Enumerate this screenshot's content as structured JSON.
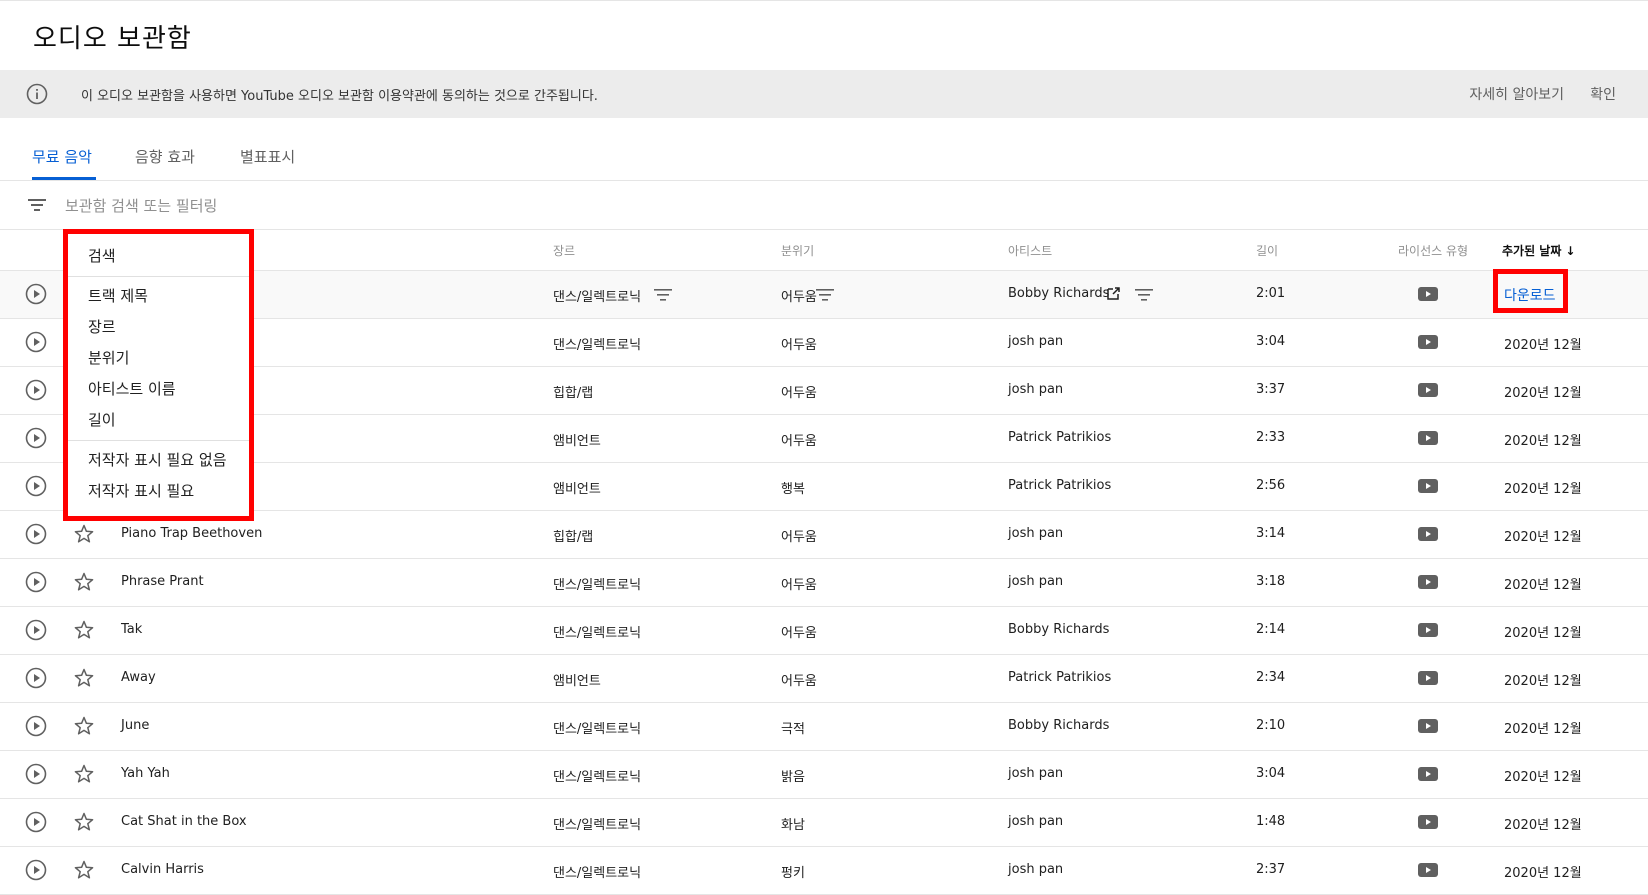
{
  "page": {
    "title": "오디오 보관함"
  },
  "notice": {
    "text": "이 오디오 보관함을 사용하면 YouTube 오디오 보관함 이용약관에 동의하는 것으로 간주됩니다.",
    "learn_more": "자세히 알아보기",
    "confirm": "확인"
  },
  "tabs": [
    {
      "label": "무료 음악",
      "active": true
    },
    {
      "label": "음향 효과",
      "active": false
    },
    {
      "label": "별표표시",
      "active": false
    }
  ],
  "filter": {
    "placeholder": "보관함 검색 또는 필터링",
    "value": ""
  },
  "columns": {
    "genre": "장르",
    "mood": "분위기",
    "artist": "아티스트",
    "length": "길이",
    "license": "라이선스 유형",
    "date_added": "추가된 날짜"
  },
  "sort": {
    "column": "date_added",
    "direction": "desc",
    "icon": "arrow-down-icon"
  },
  "filter_menu": {
    "items": [
      "검색",
      "트랙 제목",
      "장르",
      "분위기",
      "아티스트 이름",
      "길이",
      "저작자 표시 필요 없음",
      "저작자 표시 필요"
    ]
  },
  "rows": [
    {
      "title": "",
      "genre": "댄스/일렉트로닉",
      "mood": "어두움",
      "artist": "Bobby Richards",
      "length": "2:01",
      "license_icon": "youtube-icon",
      "date": "",
      "download": "다운로드"
    },
    {
      "title": "",
      "genre": "댄스/일렉트로닉",
      "mood": "어두움",
      "artist": "josh pan",
      "length": "3:04",
      "license_icon": "youtube-icon",
      "date": "2020년 12월"
    },
    {
      "title": "",
      "genre": "힙합/랩",
      "mood": "어두움",
      "artist": "josh pan",
      "length": "3:37",
      "license_icon": "youtube-icon",
      "date": "2020년 12월"
    },
    {
      "title": "",
      "genre": "앰비언트",
      "mood": "어두움",
      "artist": "Patrick Patrikios",
      "length": "2:33",
      "license_icon": "youtube-icon",
      "date": "2020년 12월"
    },
    {
      "title": "",
      "genre": "앰비언트",
      "mood": "행복",
      "artist": "Patrick Patrikios",
      "length": "2:56",
      "license_icon": "youtube-icon",
      "date": "2020년 12월"
    },
    {
      "title": "Piano Trap Beethoven",
      "genre": "힙합/랩",
      "mood": "어두움",
      "artist": "josh pan",
      "length": "3:14",
      "license_icon": "youtube-icon",
      "date": "2020년 12월"
    },
    {
      "title": "Phrase Prant",
      "genre": "댄스/일렉트로닉",
      "mood": "어두움",
      "artist": "josh pan",
      "length": "3:18",
      "license_icon": "youtube-icon",
      "date": "2020년 12월"
    },
    {
      "title": "Tak",
      "genre": "댄스/일렉트로닉",
      "mood": "어두움",
      "artist": "Bobby Richards",
      "length": "2:14",
      "license_icon": "youtube-icon",
      "date": "2020년 12월"
    },
    {
      "title": "Away",
      "genre": "앰비언트",
      "mood": "어두움",
      "artist": "Patrick Patrikios",
      "length": "2:34",
      "license_icon": "youtube-icon",
      "date": "2020년 12월"
    },
    {
      "title": "June",
      "genre": "댄스/일렉트로닉",
      "mood": "극적",
      "artist": "Bobby Richards",
      "length": "2:10",
      "license_icon": "youtube-icon",
      "date": "2020년 12월"
    },
    {
      "title": "Yah Yah",
      "genre": "댄스/일렉트로닉",
      "mood": "밝음",
      "artist": "josh pan",
      "length": "3:04",
      "license_icon": "youtube-icon",
      "date": "2020년 12월"
    },
    {
      "title": "Cat Shat in the Box",
      "genre": "댄스/일렉트로닉",
      "mood": "화남",
      "artist": "josh pan",
      "length": "1:48",
      "license_icon": "youtube-icon",
      "date": "2020년 12월"
    },
    {
      "title": "Calvin Harris",
      "genre": "댄스/일렉트로닉",
      "mood": "펑키",
      "artist": "josh pan",
      "length": "2:37",
      "license_icon": "youtube-icon",
      "date": "2020년 12월"
    }
  ],
  "colors": {
    "accent": "#065fd4",
    "highlight": "#ff0000",
    "notice_bg": "#ececec",
    "youtube_icon": "#606060"
  }
}
